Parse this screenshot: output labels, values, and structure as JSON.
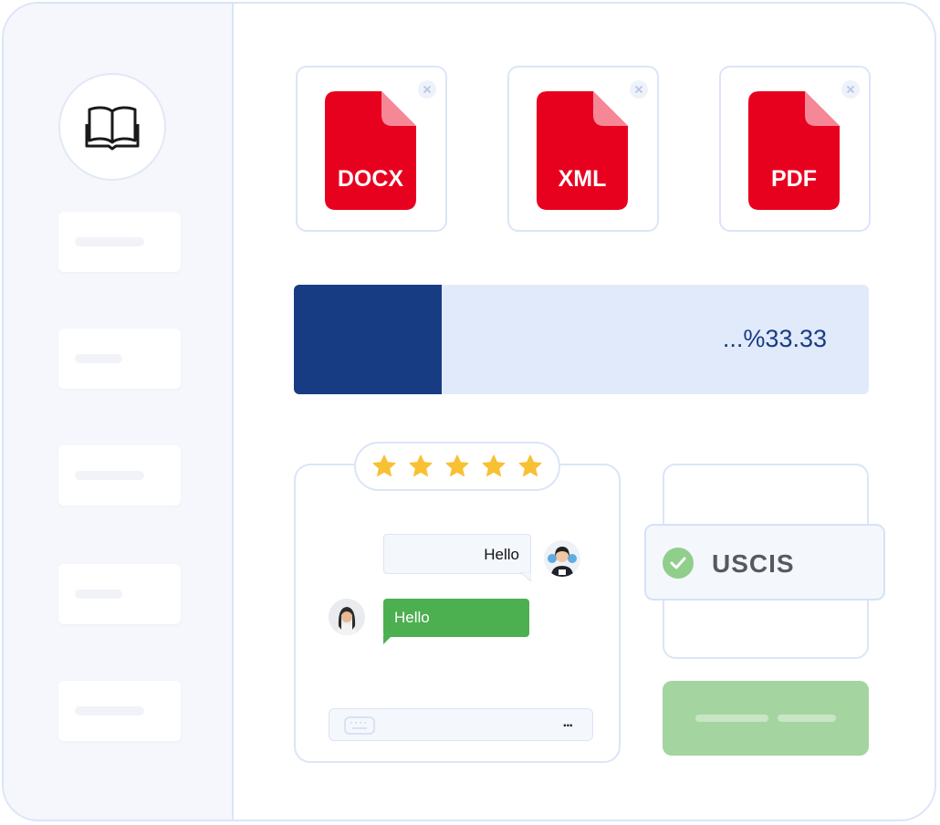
{
  "files": [
    {
      "label": "DOCX"
    },
    {
      "label": "XML"
    },
    {
      "label": "PDF"
    }
  ],
  "progress": {
    "text": "...%33.33",
    "fraction": 0.2571
  },
  "rating": {
    "stars": 5
  },
  "chat": {
    "incoming": "Hello",
    "outgoing": "Hello",
    "input_trailing": "..."
  },
  "status": {
    "label": "USCIS"
  },
  "colors": {
    "file_red": "#e8001f",
    "file_fold": "#f68797",
    "progress_fill": "#183c83",
    "progress_track": "#e1eafa",
    "star": "#f8c033",
    "chat_green": "#4caf50",
    "check_green": "#90ce8c",
    "button_green": "#a4d5a0"
  },
  "icons": {
    "logo": "open-book-icon",
    "close": "close-icon",
    "star": "star-icon",
    "keyboard": "keyboard-icon",
    "check": "check-icon"
  }
}
